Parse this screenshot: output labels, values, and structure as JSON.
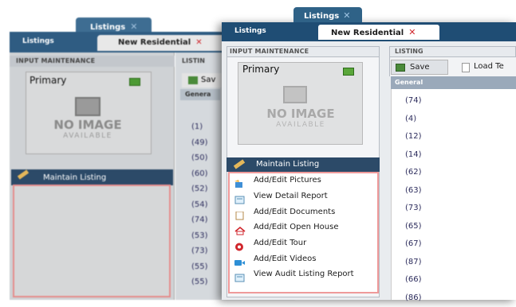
{
  "back": {
    "top_tab": "Listings",
    "nav_label": "Listings",
    "sub_tab": "New Residential",
    "left_header": "INPUT MAINTENANCE",
    "image_label": "Primary",
    "no_image_big": "NO IMAGE",
    "no_image_small": "AVAILABLE",
    "maintain_label": "Maintain Listing",
    "right_header": "LISTIN",
    "save_label": "Sav",
    "general_label": "Genera",
    "values": [
      "(1)",
      "(49)",
      "(50)",
      "(60)",
      "(52)",
      "(54)",
      "(74)",
      "(53)",
      "(73)",
      "(55)",
      "(55)"
    ]
  },
  "front": {
    "top_tab": "Listings",
    "close_glyph": "✕",
    "nav_label": "Listings",
    "sub_tab": "New Residential",
    "sub_tab_close": "✕",
    "left_header": "INPUT MAINTENANCE",
    "image_label": "Primary",
    "no_image_big": "NO IMAGE",
    "no_image_small": "AVAILABLE",
    "maintain_label": "Maintain Listing",
    "menu": [
      {
        "label": "Add/Edit Pictures",
        "icon": "pictures-icon"
      },
      {
        "label": "View Detail Report",
        "icon": "report-icon"
      },
      {
        "label": "Add/Edit Documents",
        "icon": "document-icon"
      },
      {
        "label": "Add/Edit Open House",
        "icon": "open-house-icon"
      },
      {
        "label": "Add/Edit Tour",
        "icon": "tour-icon"
      },
      {
        "label": "Add/Edit Videos",
        "icon": "video-icon"
      },
      {
        "label": "View Audit Listing Report",
        "icon": "audit-report-icon"
      }
    ],
    "right_header": "LISTING",
    "save_label": "Save",
    "load_template_label": "Load Te",
    "general_label": "General",
    "values": [
      "(74)",
      "(4)",
      "(12)",
      "(14)",
      "(62)",
      "(63)",
      "(73)",
      "(65)",
      "(67)",
      "(87)",
      "(66)",
      "(86)"
    ]
  },
  "colors": {
    "nav_blue": "#1f4d74",
    "maintain_bar": "#2c4a68",
    "highlight_red": "#ef9a9a",
    "close_red": "#d0262c"
  }
}
